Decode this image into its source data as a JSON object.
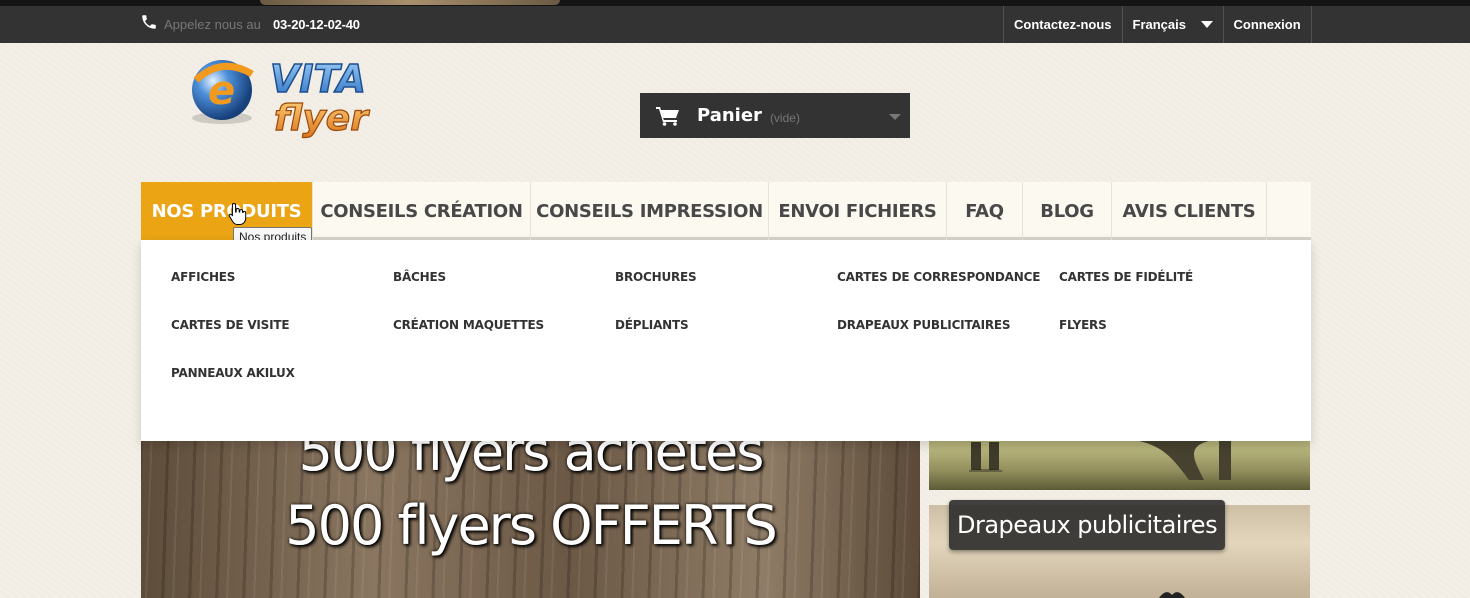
{
  "topbar": {
    "phone_label": "Appelez nous au",
    "phone_number": "03-20-12-02-40",
    "links": {
      "contact": "Contactez-nous",
      "language": "Français",
      "login": "Connexion"
    }
  },
  "header": {
    "logo_text": "VITA flyer",
    "cart_label": "Panier",
    "cart_status": "(vide)"
  },
  "menu": {
    "items": [
      {
        "label": "NOS PRODUITS",
        "active": true
      },
      {
        "label": "CONSEILS CRÉATION"
      },
      {
        "label": "CONSEILS IMPRESSION"
      },
      {
        "label": "ENVOI FICHIERS"
      },
      {
        "label": "FAQ"
      },
      {
        "label": "BLOG"
      },
      {
        "label": "AVIS CLIENTS"
      }
    ],
    "tooltip": "Nos produits",
    "accent_color": "#eaa414"
  },
  "dropdown": {
    "items": [
      "AFFICHES",
      "BÂCHES",
      "BROCHURES",
      "CARTES DE CORRESPONDANCE",
      "CARTES DE FIDÉLITÉ",
      "CARTES DE VISITE",
      "CRÉATION MAQUETTES",
      "DÉPLIANTS",
      "DRAPEAUX PUBLICITAIRES",
      "FLYERS",
      "PANNEAUX AKILUX"
    ]
  },
  "banner": {
    "line1": "500  flyers achetés",
    "line2": "500  flyers OFFERTS"
  },
  "tiles": {
    "tile2_label": "Drapeaux publicitaires"
  },
  "icons": [
    "phone-icon",
    "cart-icon",
    "chevron-down-icon",
    "hand-cursor-icon"
  ]
}
